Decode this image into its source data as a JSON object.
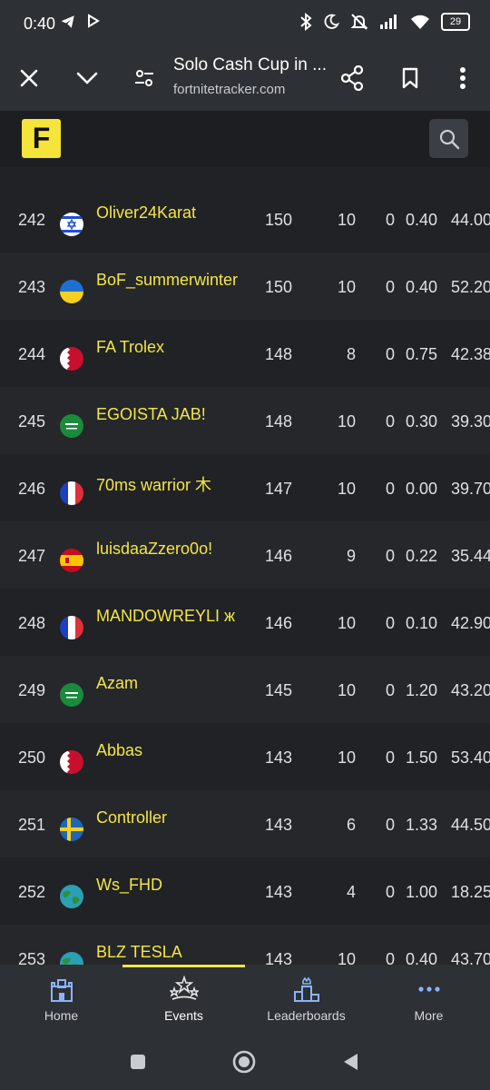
{
  "status": {
    "time": "0:40",
    "battery": "29"
  },
  "browser": {
    "title": "Solo Cash Cup in ...",
    "url": "fortnitetracker.com"
  },
  "site": {
    "logo_text": "F"
  },
  "rows": [
    {
      "rank": "242",
      "flag": "israel",
      "name": "Oliver24Karat",
      "points": "150",
      "wins": "10",
      "zero": "0",
      "kd": "0.40",
      "avg": "44.00"
    },
    {
      "rank": "243",
      "flag": "ukraine",
      "name": "BoF_summerwinter",
      "points": "150",
      "wins": "10",
      "zero": "0",
      "kd": "0.40",
      "avg": "52.20"
    },
    {
      "rank": "244",
      "flag": "bahrain",
      "name": "FA Trolex",
      "points": "148",
      "wins": "8",
      "zero": "0",
      "kd": "0.75",
      "avg": "42.38"
    },
    {
      "rank": "245",
      "flag": "saudi",
      "name": "EGOISTA JAB!",
      "points": "148",
      "wins": "10",
      "zero": "0",
      "kd": "0.30",
      "avg": "39.30"
    },
    {
      "rank": "246",
      "flag": "france",
      "name": "70ms warrior 木",
      "points": "147",
      "wins": "10",
      "zero": "0",
      "kd": "0.00",
      "avg": "39.70"
    },
    {
      "rank": "247",
      "flag": "spain",
      "name": "luisdaaZzero0o!",
      "points": "146",
      "wins": "9",
      "zero": "0",
      "kd": "0.22",
      "avg": "35.44"
    },
    {
      "rank": "248",
      "flag": "france",
      "name": "MANDOWREYLI ж",
      "points": "146",
      "wins": "10",
      "zero": "0",
      "kd": "0.10",
      "avg": "42.90"
    },
    {
      "rank": "249",
      "flag": "saudi",
      "name": "Azam",
      "points": "145",
      "wins": "10",
      "zero": "0",
      "kd": "1.20",
      "avg": "43.20"
    },
    {
      "rank": "250",
      "flag": "bahrain",
      "name": "Abbas",
      "points": "143",
      "wins": "10",
      "zero": "0",
      "kd": "1.50",
      "avg": "53.40"
    },
    {
      "rank": "251",
      "flag": "sweden",
      "name": "Controller",
      "points": "143",
      "wins": "6",
      "zero": "0",
      "kd": "1.33",
      "avg": "44.50"
    },
    {
      "rank": "252",
      "flag": "globe",
      "name": "Ws_FHD",
      "points": "143",
      "wins": "4",
      "zero": "0",
      "kd": "1.00",
      "avg": "18.25"
    },
    {
      "rank": "253",
      "flag": "globe",
      "name": "BLZ TESLA",
      "points": "143",
      "wins": "10",
      "zero": "0",
      "kd": "0.40",
      "avg": "43.70"
    }
  ],
  "tabs": [
    {
      "label": "Home",
      "icon": "castle-icon"
    },
    {
      "label": "Events",
      "icon": "stars-icon"
    },
    {
      "label": "Leaderboards",
      "icon": "podium-icon"
    },
    {
      "label": "More",
      "icon": "more-dots-icon"
    }
  ],
  "colors": {
    "accent": "#f4e646",
    "tab_icon": "#8ab4f8"
  }
}
